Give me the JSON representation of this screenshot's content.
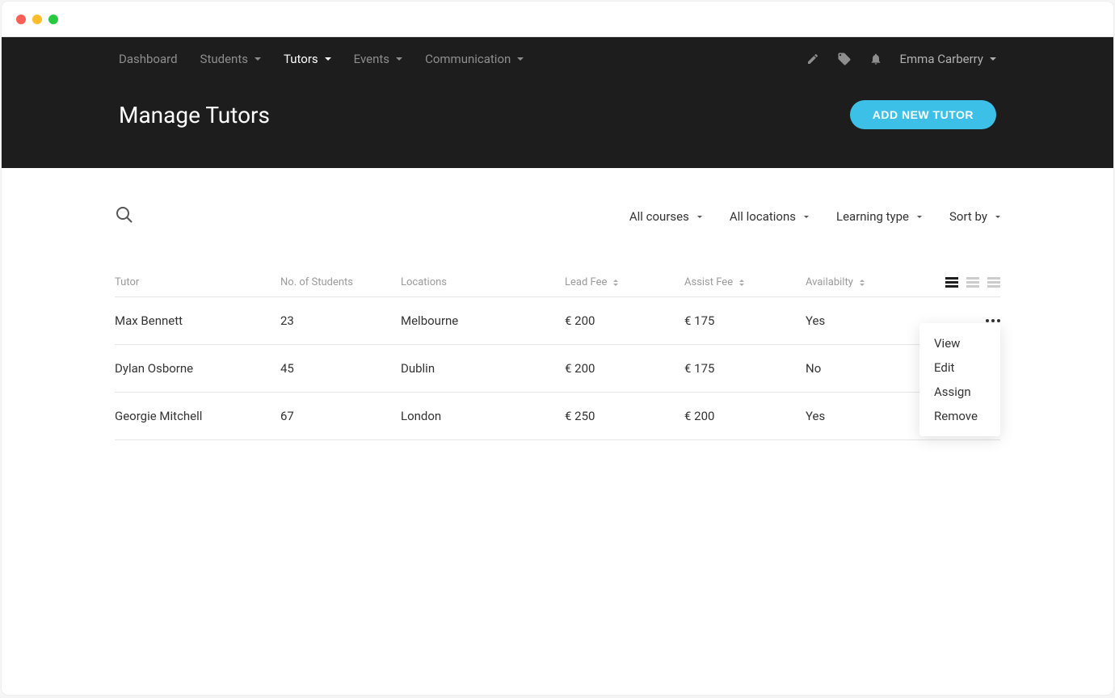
{
  "nav": {
    "items": [
      {
        "label": "Dashboard",
        "has_caret": false,
        "active": false
      },
      {
        "label": "Students",
        "has_caret": true,
        "active": false
      },
      {
        "label": "Tutors",
        "has_caret": true,
        "active": true
      },
      {
        "label": "Events",
        "has_caret": true,
        "active": false
      },
      {
        "label": "Communication",
        "has_caret": true,
        "active": false
      }
    ],
    "user_name": "Emma Carberry"
  },
  "page": {
    "title": "Manage Tutors",
    "add_button_label": "ADD NEW TUTOR"
  },
  "filters": {
    "courses": "All courses",
    "locations": "All locations",
    "learning_type": "Learning type",
    "sort_by": "Sort by"
  },
  "table": {
    "headers": {
      "tutor": "Tutor",
      "students": "No. of Students",
      "locations": "Locations",
      "lead_fee": "Lead Fee",
      "assist_fee": "Assist Fee",
      "availability": "Availabilty"
    },
    "rows": [
      {
        "tutor": "Max Bennett",
        "students": "23",
        "locations": "Melbourne",
        "lead_fee": "€ 200",
        "assist_fee": "€ 175",
        "availability": "Yes"
      },
      {
        "tutor": "Dylan Osborne",
        "students": "45",
        "locations": "Dublin",
        "lead_fee": "€ 200",
        "assist_fee": "€ 175",
        "availability": "No"
      },
      {
        "tutor": "Georgie Mitchell",
        "students": "67",
        "locations": "London",
        "lead_fee": "€ 250",
        "assist_fee": "€ 200",
        "availability": "Yes"
      }
    ]
  },
  "context_menu": {
    "items": [
      {
        "label": "View"
      },
      {
        "label": "Edit"
      },
      {
        "label": "Assign"
      },
      {
        "label": "Remove"
      }
    ]
  }
}
